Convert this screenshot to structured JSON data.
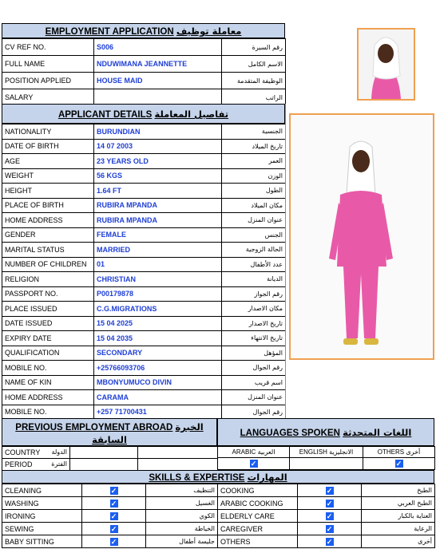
{
  "header": {
    "title_en": "EMPLOYMENT APPLICATION",
    "title_ar": "معاملة توظيف"
  },
  "top_rows": [
    {
      "label": "CV REF NO.",
      "value": "S006",
      "ar": "رقم السيرة"
    },
    {
      "label": "FULL NAME",
      "value": "NDUWIMANA JEANNETTE",
      "ar": "الاسم الكامل"
    },
    {
      "label": "POSITION APPLIED",
      "value": "HOUSE MAID",
      "ar": "الوظيفة المتقدمة"
    },
    {
      "label": "SALARY",
      "value": "",
      "ar": "الراتب"
    }
  ],
  "applicant_header": {
    "en": "APPLICANT DETAILS",
    "ar": "تفاصيل المعاملة"
  },
  "details": [
    {
      "label": "NATIONALITY",
      "value": "BURUNDIAN",
      "ar": "الجنسية"
    },
    {
      "label": "DATE OF BIRTH",
      "value": "14 07 2003",
      "ar": "تاريخ الميلاد"
    },
    {
      "label": "AGE",
      "value": "23 YEARS OLD",
      "ar": "العمر"
    },
    {
      "label": "WEIGHT",
      "value": "56 KGS",
      "ar": "الوزن"
    },
    {
      "label": "HEIGHT",
      "value": "1.64 FT",
      "ar": "الطول"
    },
    {
      "label": "PLACE OF BIRTH",
      "value": "RUBIRA MPANDA",
      "ar": "مكان الميلاد"
    },
    {
      "label": "HOME ADDRESS",
      "value": "RUBIRA MPANDA",
      "ar": "عنوان المنزل"
    },
    {
      "label": "GENDER",
      "value": "FEMALE",
      "ar": "الجنس"
    },
    {
      "label": "MARITAL STATUS",
      "value": "MARRIED",
      "ar": "الحالة الزوجية"
    },
    {
      "label": "NUMBER OF CHILDREN",
      "value": "01",
      "ar": "عدد الأطفال"
    },
    {
      "label": "RELIGION",
      "value": "CHRISTIAN",
      "ar": "الديانة"
    },
    {
      "label": "PASSPORT NO.",
      "value": "P00179878",
      "ar": "رقم الجواز"
    },
    {
      "label": "PLACE ISSUED",
      "value": "C.G.MIGRATIONS",
      "ar": "مكان الاصدار"
    },
    {
      "label": "DATE ISSUED",
      "value": "15 04 2025",
      "ar": "تاريخ الاصدار"
    },
    {
      "label": "EXPIRY DATE",
      "value": "15 04 2035",
      "ar": "تاريخ الانتهاء"
    },
    {
      "label": "QUALIFICATION",
      "value": "SECONDARY",
      "ar": "المؤهل"
    },
    {
      "label": "MOBILE NO.",
      "value": "+25766093706",
      "ar": "رقم الجوال"
    },
    {
      "label": "NAME OF KIN",
      "value": "MBONYUMUCO DIVIN",
      "ar": "اسم قريب"
    },
    {
      "label": "HOME ADDRESS",
      "value": "CARAMA",
      "ar": "عنوان المنزل"
    },
    {
      "label": "MOBILE NO.",
      "value": "+257 71700431",
      "ar": "رقم الجوال"
    }
  ],
  "prev_employment": {
    "en": "PREVIOUS EMPLOYMENT ABROAD",
    "ar": "الخبرة السابقة"
  },
  "prev_rows": [
    {
      "label": "COUNTRY",
      "ar": "الدولة"
    },
    {
      "label": "PERIOD",
      "ar": "الفترة"
    }
  ],
  "languages": {
    "en": "LANGUAGES SPOKEN",
    "ar": "اللغات المتحدثة",
    "items": [
      {
        "en": "ARABIC",
        "ar": "العربية",
        "checked": true
      },
      {
        "en": "ENGLISH",
        "ar": "الانجليزية",
        "checked": false
      },
      {
        "en": "OTHERS",
        "ar": "أخرى",
        "checked": true
      }
    ]
  },
  "skills": {
    "en": "SKILLS & EXPERTISE",
    "ar": "المهارات",
    "left": [
      {
        "en": "CLEANING",
        "ar": "التنظيف",
        "checked": true
      },
      {
        "en": "WASHING",
        "ar": "الغسيل",
        "checked": true
      },
      {
        "en": "IRONING",
        "ar": "الكوي",
        "checked": true
      },
      {
        "en": "SEWING",
        "ar": "الخياطة",
        "checked": true
      },
      {
        "en": "BABY SITTING",
        "ar": "جليسة أطفال",
        "checked": true
      }
    ],
    "right": [
      {
        "en": "COOKING",
        "ar": "الطبخ",
        "checked": true
      },
      {
        "en": "ARABIC COOKING",
        "ar": "الطبخ العربي",
        "checked": true
      },
      {
        "en": "ELDERLY CARE",
        "ar": "العناية بالكبار",
        "checked": true
      },
      {
        "en": "CAREGIVER",
        "ar": "الرعاية",
        "checked": true
      },
      {
        "en": "OTHERS",
        "ar": "أخرى",
        "checked": true
      }
    ]
  },
  "check_glyph": "✓",
  "colors": {
    "header_bg": "#c5d4ea",
    "value_text": "#1f3fd6",
    "checkbox": "#1b5ff0",
    "photo_border": "#f0a050",
    "uniform": "#e85aa8"
  }
}
